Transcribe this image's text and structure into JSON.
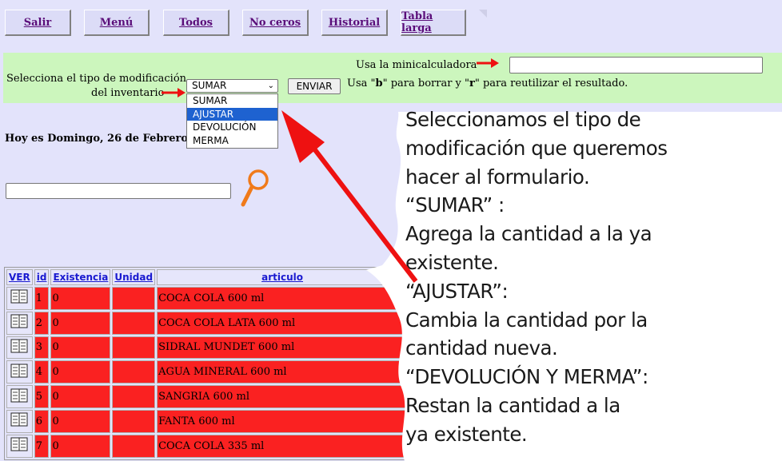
{
  "nav": {
    "buttons": [
      {
        "label": "Salir"
      },
      {
        "label": "Menú"
      },
      {
        "label": "Todos"
      },
      {
        "label": "No ceros"
      },
      {
        "label": "Historial"
      },
      {
        "label": "Tabla larga"
      }
    ]
  },
  "form": {
    "select_label_line1": "Selecciona el tipo de modificación",
    "select_label_line2": "del inventario",
    "selected_value": "SUMAR",
    "options": [
      "SUMAR",
      "AJUSTAR",
      "DEVOLUCIÓN",
      "MERMA"
    ],
    "highlighted_option": "AJUSTAR",
    "submit_label": "ENVIAR",
    "calc_label": "Usa la minicalculadora",
    "calc_value": "",
    "calc_help_prefix": "Usa \"",
    "calc_help_b": "b",
    "calc_help_mid": "\" para borrar y \"",
    "calc_help_r": "r",
    "calc_help_suffix": "\" para reutilizar el resultado."
  },
  "date_text": "Hoy es Domingo, 26 de Febrero de",
  "search": {
    "value": ""
  },
  "table": {
    "headers": [
      "VER",
      "id",
      "Existencia",
      "Unidad",
      "articulo"
    ],
    "rows": [
      {
        "id": "1",
        "existencia": "0",
        "unidad": "",
        "articulo": "COCA COLA 600 ml"
      },
      {
        "id": "2",
        "existencia": "0",
        "unidad": "",
        "articulo": "COCA COLA LATA 600 ml"
      },
      {
        "id": "3",
        "existencia": "0",
        "unidad": "",
        "articulo": "SIDRAL MUNDET 600 ml"
      },
      {
        "id": "4",
        "existencia": "0",
        "unidad": "",
        "articulo": "AGUA MINERAL 600 ml"
      },
      {
        "id": "5",
        "existencia": "0",
        "unidad": "",
        "articulo": "SANGRIA 600 ml"
      },
      {
        "id": "6",
        "existencia": "0",
        "unidad": "",
        "articulo": "FANTA 600 ml"
      },
      {
        "id": "7",
        "existencia": "0",
        "unidad": "",
        "articulo": "COCA COLA 335 ml"
      }
    ]
  },
  "annotation": {
    "lines": [
      "Seleccionamos el tipo de",
      "modificación que queremos",
      "hacer al formulario.",
      "“SUMAR” :",
      "Agrega la cantidad a la ya",
      "existente.",
      "“AJUSTAR”:",
      "Cambia la cantidad por la",
      "cantidad nueva.",
      "“DEVOLUCIÓN Y MERMA”:",
      "Restan la cantidad a la",
      "ya existente."
    ]
  },
  "colors": {
    "page_bg": "#e3e3fb",
    "form_bg": "#ccf6bd",
    "row_bg": "#fa2121",
    "arrow": "#ee1111",
    "link": "#1a1ad0",
    "nav_text": "#5a0d79"
  },
  "icons": {
    "book": "book-icon",
    "search": "magnifier-icon",
    "arrow": "red-arrow"
  }
}
